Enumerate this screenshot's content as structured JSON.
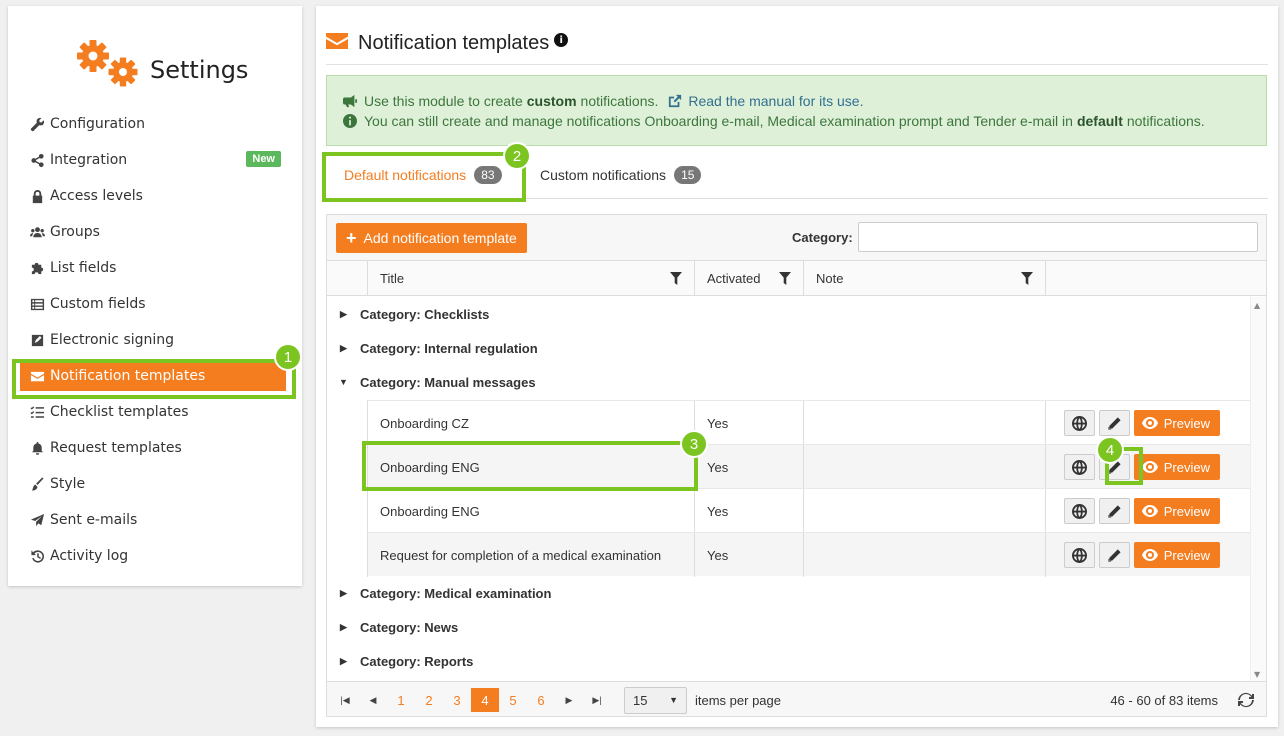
{
  "sidebar": {
    "title": "Settings",
    "items": [
      {
        "label": "Configuration",
        "icon": "wrench-icon"
      },
      {
        "label": "Integration",
        "icon": "share-icon",
        "badge": "New"
      },
      {
        "label": "Access levels",
        "icon": "lock-icon"
      },
      {
        "label": "Groups",
        "icon": "users-icon"
      },
      {
        "label": "List fields",
        "icon": "puzzle-icon"
      },
      {
        "label": "Custom fields",
        "icon": "list-icon"
      },
      {
        "label": "Electronic signing",
        "icon": "signature-icon"
      },
      {
        "label": "Notification templates",
        "icon": "envelope-icon",
        "active": true
      },
      {
        "label": "Checklist templates",
        "icon": "checklist-icon"
      },
      {
        "label": "Request templates",
        "icon": "bell-icon"
      },
      {
        "label": "Style",
        "icon": "brush-icon"
      },
      {
        "label": "Sent e-mails",
        "icon": "paper-plane-icon"
      },
      {
        "label": "Activity log",
        "icon": "history-icon"
      }
    ]
  },
  "callouts": [
    "1",
    "2",
    "3",
    "4"
  ],
  "main": {
    "title": "Notification templates",
    "info": "i",
    "alert": {
      "line1_pre": "Use this module to create",
      "line1_bold": "custom",
      "line1_post": "notifications.",
      "manual_link": "Read the manual for its use.",
      "line2_pre": "You can still create and manage notifications Onboarding e-mail, Medical examination prompt and Tender e-mail in",
      "line2_bold": "default",
      "line2_post": "notifications."
    },
    "tabs": [
      {
        "label": "Default notifications",
        "count": "83",
        "active": true
      },
      {
        "label": "Custom notifications",
        "count": "15"
      }
    ],
    "toolbar": {
      "add_label": "Add notification template",
      "category_label": "Category:",
      "category_value": ""
    },
    "columns": [
      "Title",
      "Activated",
      "Note"
    ],
    "groups": [
      {
        "label": "Category: Checklists",
        "expanded": false
      },
      {
        "label": "Category: Internal regulation",
        "expanded": false
      },
      {
        "label": "Category: Manual messages",
        "expanded": true
      },
      {
        "label": "Category: Medical examination",
        "expanded": false
      },
      {
        "label": "Category: News",
        "expanded": false
      },
      {
        "label": "Category: Reports",
        "expanded": false
      }
    ],
    "rows": [
      {
        "title": "Onboarding CZ",
        "activated": "Yes",
        "note": ""
      },
      {
        "title": "Onboarding ENG",
        "activated": "Yes",
        "note": ""
      },
      {
        "title": "Onboarding ENG",
        "activated": "Yes",
        "note": ""
      },
      {
        "title": "Request for completion of a medical examination",
        "activated": "Yes",
        "note": ""
      }
    ],
    "preview_label": "Preview",
    "pager": {
      "pages": [
        "1",
        "2",
        "3",
        "4",
        "5",
        "6"
      ],
      "current": "4",
      "per_page": "15",
      "per_page_label": "items per page",
      "range": "46 - 60 of 83 items"
    }
  },
  "colors": {
    "accent": "#f47d20",
    "highlight": "#7cc521",
    "success_bg": "#dff0d8",
    "badge_new": "#5cb85c"
  }
}
